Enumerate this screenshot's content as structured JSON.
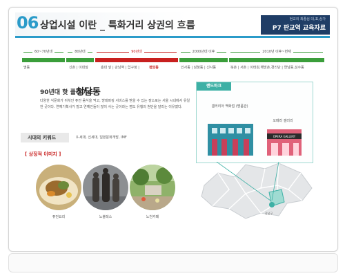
{
  "header": {
    "number": "06",
    "title": "상업시설 이란 _ 특화거리 상권의 흐름",
    "badge_sub": "현교의 최종심 대,표,상가",
    "badge_main": "P7 판교역 교육자료"
  },
  "timeline": {
    "eras": [
      {
        "label": "60~70년대",
        "color": "#3b9e3b"
      },
      {
        "label": "80년대",
        "color": "#3b9e3b"
      },
      {
        "label": "90년대",
        "color": "#c8201f"
      },
      {
        "label": "2000년대 이후",
        "color": "#3b9e3b"
      },
      {
        "label": "2010년 이후~현재",
        "color": "#3b9e3b"
      }
    ],
    "places": [
      "명동",
      "신촌 | 이대앞",
      "홍대 앞 | 강남역 | 압구정 |",
      "청담동",
      "인사동 | 삼청동 | 신사동",
      "북촌 | 서촌 | 이태원,해방촌,경리단 | 연남동,성수동"
    ]
  },
  "hot": {
    "subtitle": "90년대 핫 플레이스",
    "title": "청담동",
    "description": "다양한 식문화가 뒤섞인 퓨전 음식을 먹고, 방레파킹 서비스를 받을 수 있는 장소로는 서울 시내에서 유일한 곳이다. 연예기획사가 많고 연예인들이 많이 사는 곳이라는 점도 유행의 첨단을 달리는 이유였다."
  },
  "keyword": {
    "label": "시대의 키워드",
    "text": "X-세대, 신세대, 일본문화개방, IMF"
  },
  "symbols": {
    "label": "상징적 이미지",
    "items": [
      {
        "caption": "퓨전요리",
        "icon": "fusion-food-photo"
      },
      {
        "caption": "노블레스",
        "icon": "noblesse-statue-photo"
      },
      {
        "caption": "노천카페",
        "icon": "open-air-cafe-photo"
      }
    ]
  },
  "landmark": {
    "tag": "랜드마크",
    "galleria": "갤러리아 백화점 (명품관)",
    "opera": "오페라 갤러리",
    "opera_sign": "OPERA GALLERY",
    "map_label": "강남구"
  },
  "colors": {
    "accent": "#2b9bc9",
    "navy": "#1f3d66",
    "green": "#3b9e3b",
    "red": "#c8201f",
    "teal": "#3db0a5"
  }
}
